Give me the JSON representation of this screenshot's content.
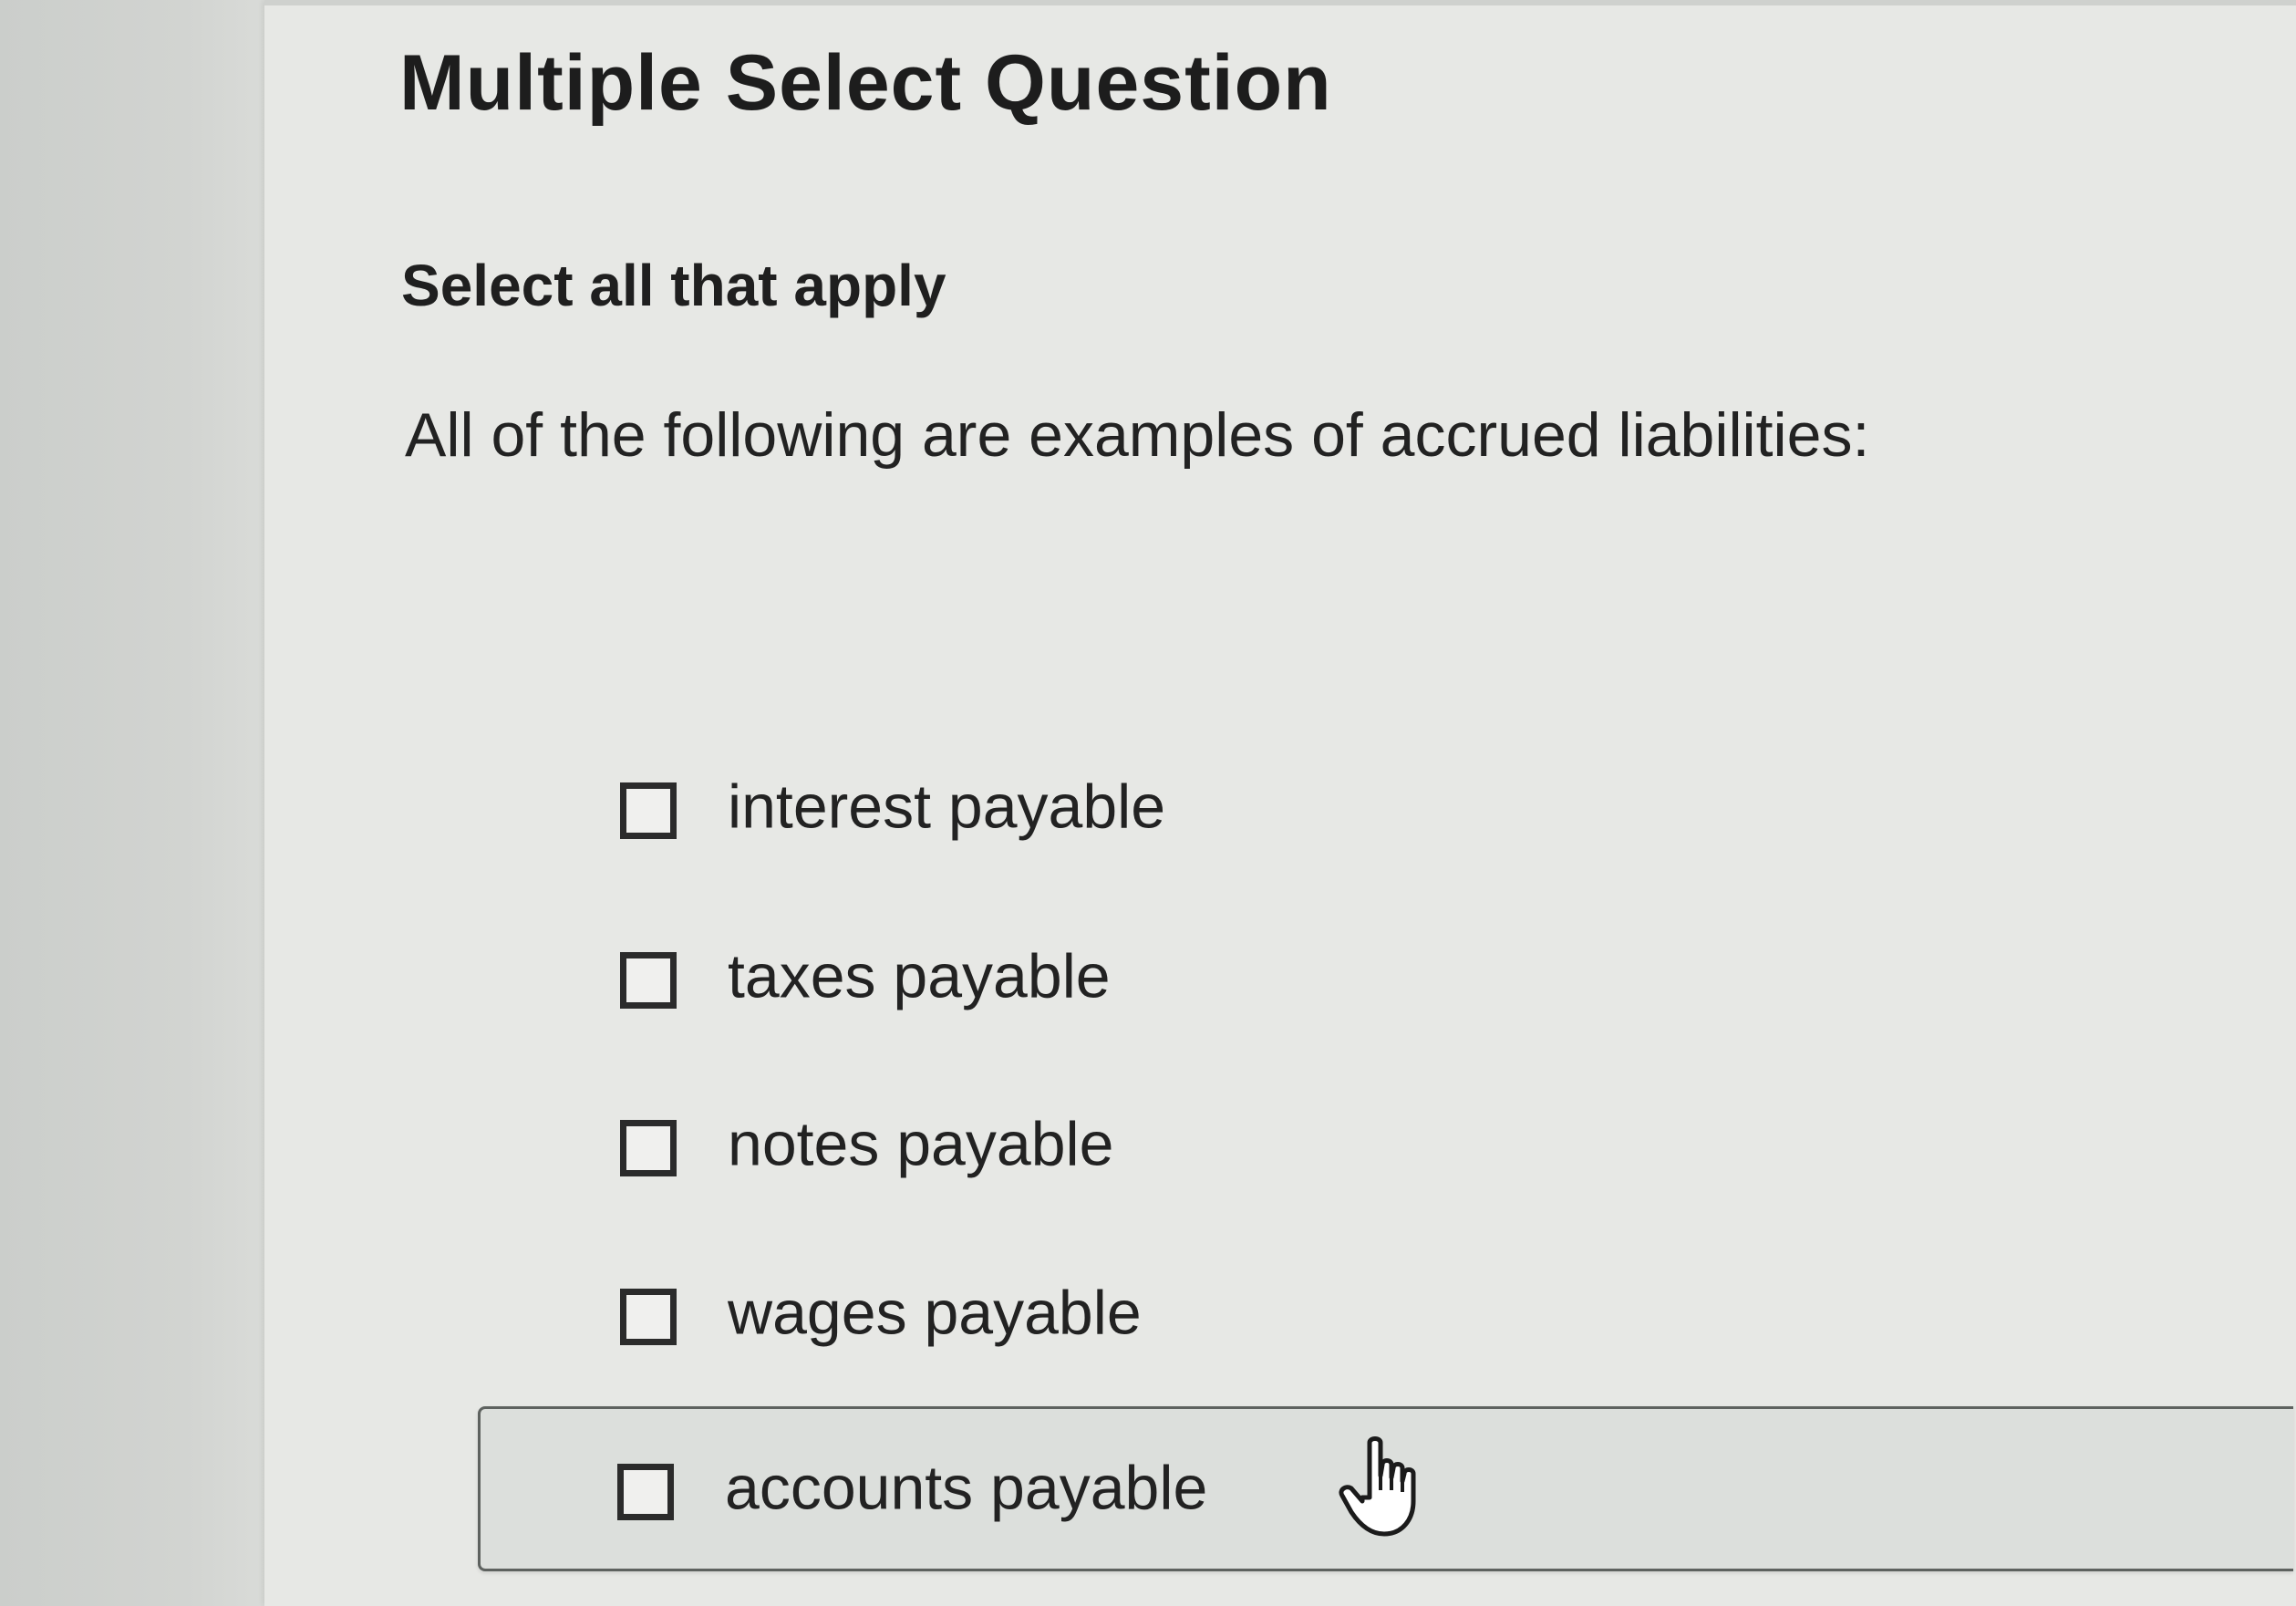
{
  "question": {
    "type_label": "Multiple Select Question",
    "instruction": "Select all that apply",
    "prompt": "All of the following are examples of accrued liabilities:"
  },
  "options": [
    {
      "label": "interest payable",
      "checked": false
    },
    {
      "label": "taxes payable",
      "checked": false
    },
    {
      "label": "notes payable",
      "checked": false
    },
    {
      "label": "wages payable",
      "checked": false
    },
    {
      "label": "accounts payable",
      "checked": false,
      "hovered": true
    }
  ],
  "cursor": {
    "icon": "hand-pointer-icon"
  }
}
